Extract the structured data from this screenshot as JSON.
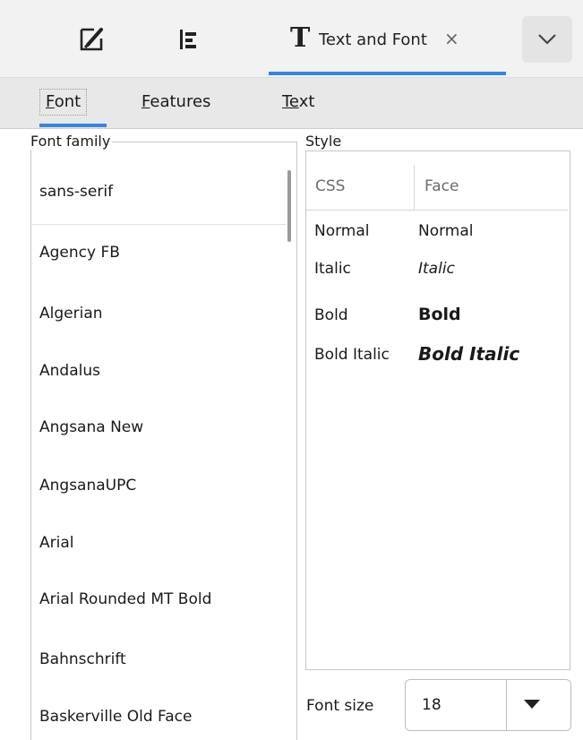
{
  "toolbar": {
    "icons": [
      "brush-icon",
      "align-icon"
    ],
    "active_tab": {
      "glyph": "T",
      "label": "Text and Font",
      "close": "×"
    },
    "dropdown_icon": "chevron-down-icon",
    "accent": "#3584e4"
  },
  "subtabs": [
    {
      "mnemonic": "F",
      "rest": "ont"
    },
    {
      "mnemonic": "F",
      "rest": "eatures"
    },
    {
      "mnemonic": "Te",
      "rest": "xt"
    }
  ],
  "font_family": {
    "legend": "Font family",
    "items": [
      "sans-serif",
      "Agency FB",
      "Algerian",
      "Andalus",
      "Angsana New",
      "AngsanaUPC",
      "Arial",
      "Arial Rounded MT Bold",
      "Bahnschrift",
      "Baskerville Old Face"
    ]
  },
  "style": {
    "legend": "Style",
    "headers": [
      "CSS",
      "Face"
    ],
    "rows": [
      {
        "css": "Normal",
        "face": "Normal"
      },
      {
        "css": "Italic",
        "face": "Italic"
      },
      {
        "css": "Bold",
        "face": "Bold"
      },
      {
        "css": "Bold Italic",
        "face": "Bold Italic"
      }
    ]
  },
  "font_size": {
    "label": "Font size",
    "value": "18"
  }
}
